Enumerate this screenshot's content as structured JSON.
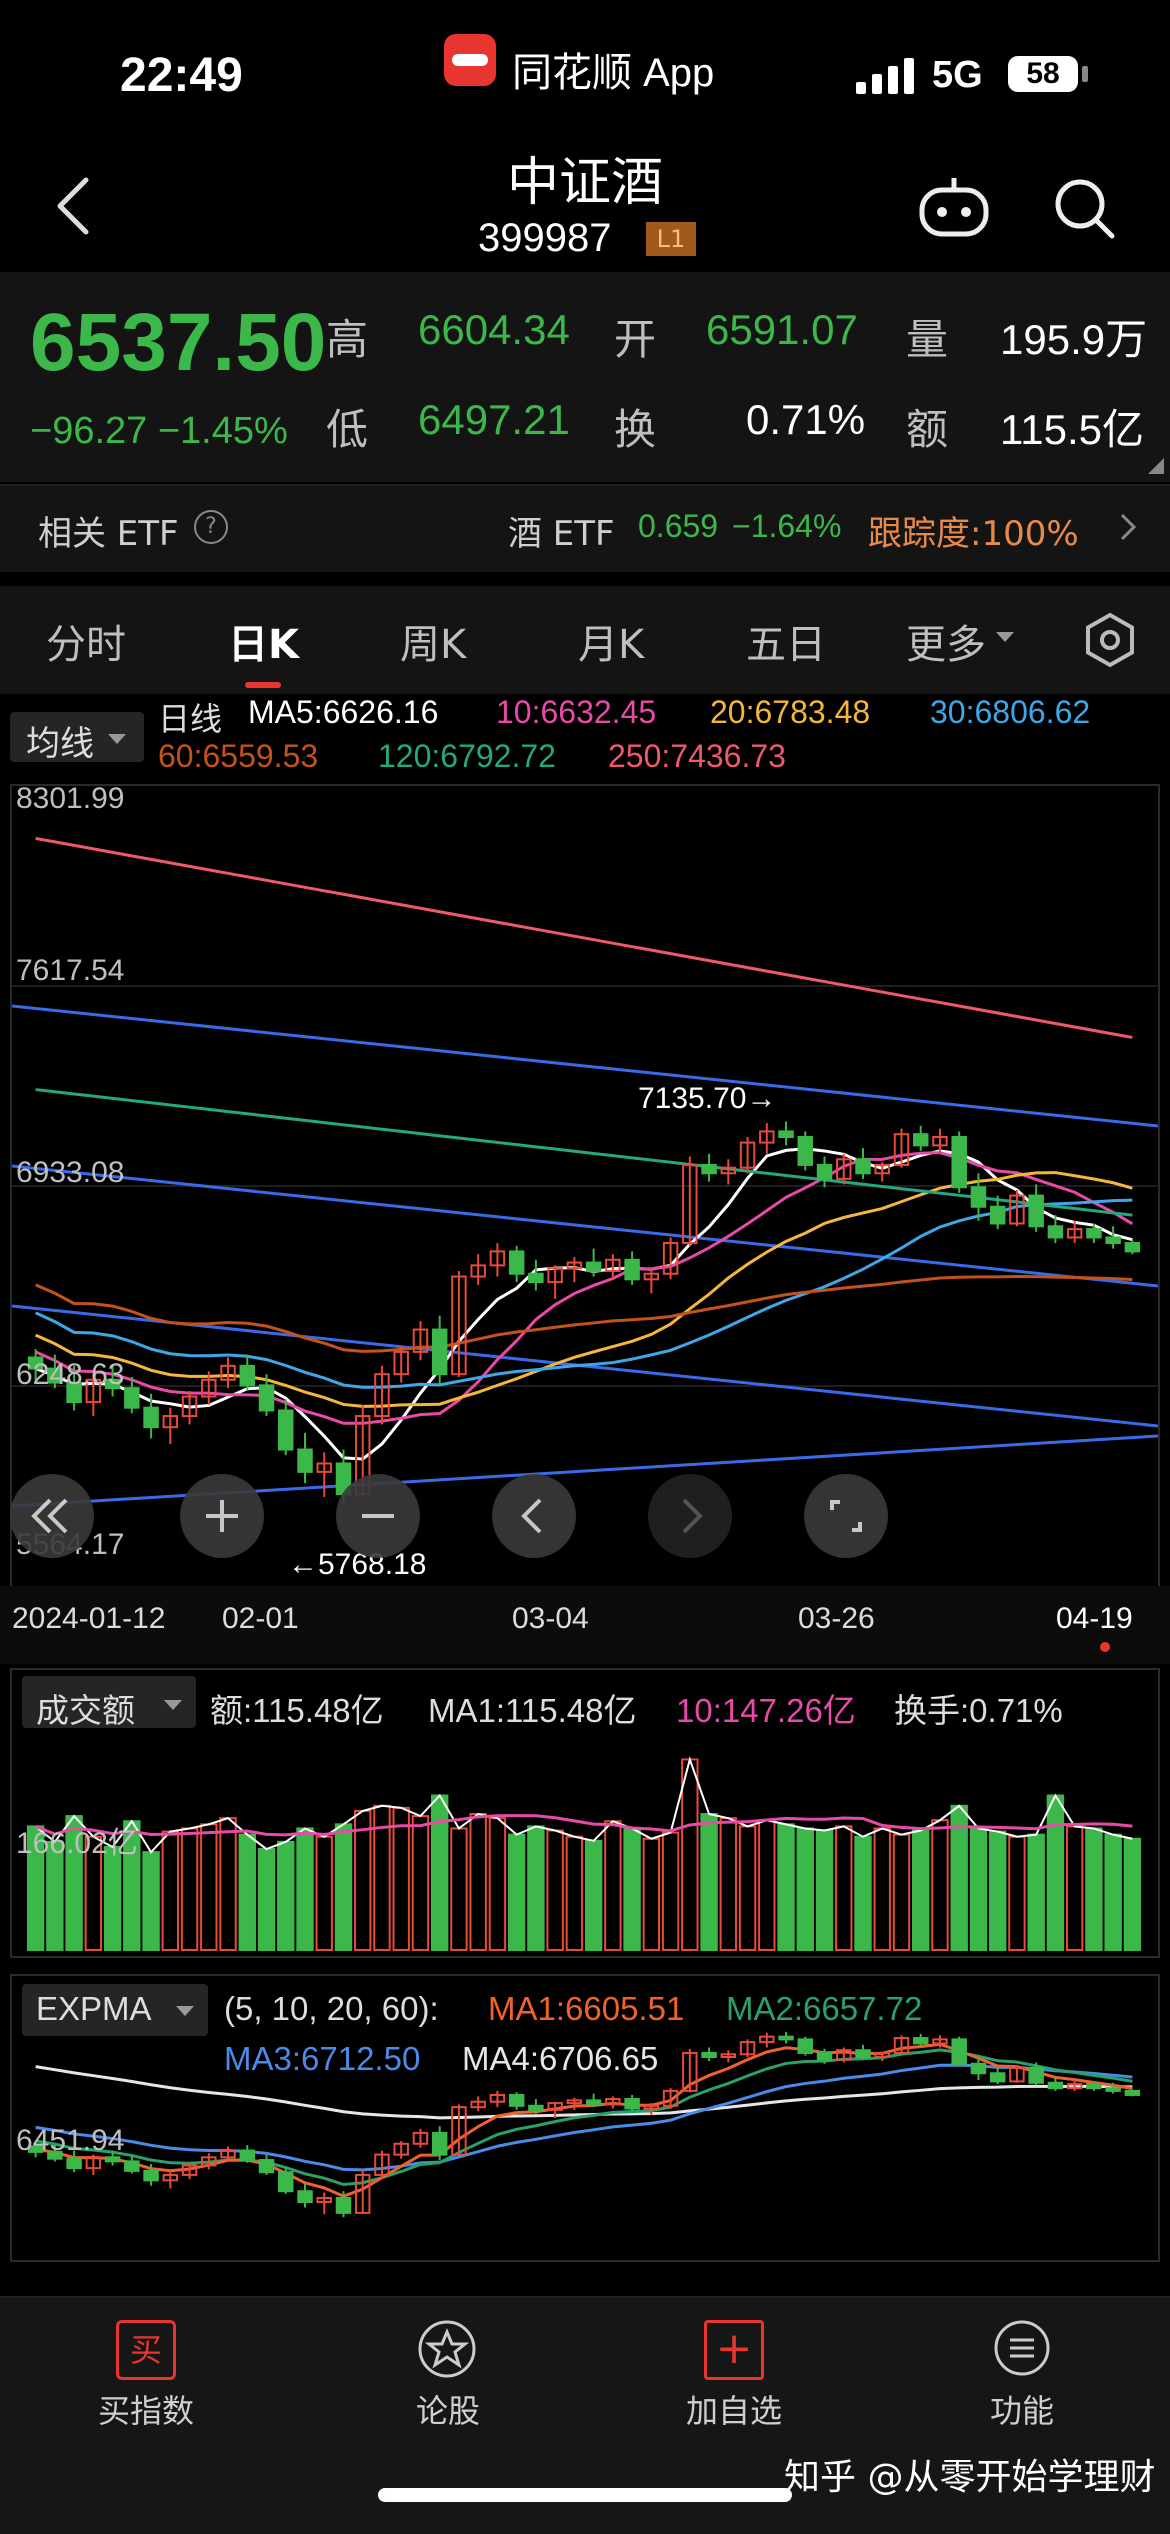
{
  "status_bar": {
    "time": "22:49",
    "app_name": "同花顺 App",
    "network": "5G",
    "battery": "58"
  },
  "header": {
    "title": "中证酒",
    "code": "399987",
    "level_badge": "L1"
  },
  "quote": {
    "price": "6537.50",
    "change": "−96.27  −1.45%",
    "high_label": "高",
    "high": "6604.34",
    "low_label": "低",
    "low": "6497.21",
    "open_label": "开",
    "open": "6591.07",
    "turnover_label": "换",
    "turnover": "0.71%",
    "volume_label": "量",
    "volume": "195.9万",
    "amount_label": "额",
    "amount": "115.5亿",
    "colors": {
      "down": "#3cb84a",
      "up": "#e84a3c"
    }
  },
  "etf": {
    "label": "相关 ETF",
    "help": "?",
    "name": "酒 ETF",
    "price": "0.659",
    "change": "−1.64%",
    "tracking": "跟踪度:100%"
  },
  "tabs": [
    "分时",
    "日K",
    "周K",
    "月K",
    "五日",
    "更多"
  ],
  "active_tab": "日K",
  "ma_legend": {
    "select": "均线",
    "period": "日线",
    "ma5": "MA5:6626.16",
    "ma10": "10:6632.45",
    "ma20": "20:6783.48",
    "ma30": "30:6806.62",
    "ma60": "60:6559.53",
    "ma120": "120:6792.72",
    "ma250": "250:7436.73",
    "colors": {
      "ma5": "#ffffff",
      "ma10": "#e84aa8",
      "ma20": "#f5b73b",
      "ma30": "#3fa7e8",
      "ma60": "#c4521c",
      "ma120": "#24a880",
      "ma250": "#ee5a6a"
    }
  },
  "kline_axis": {
    "y_ticks": [
      "8301.99",
      "7617.54",
      "6933.08",
      "6248.63",
      "5564.17"
    ],
    "high_marker": "7135.70→",
    "low_marker": "←5768.18",
    "x_ticks": [
      "2024-01-12",
      "02-01",
      "03-04",
      "03-26",
      "04-19"
    ]
  },
  "volume_panel": {
    "select": "成交额",
    "amount": "额:115.48亿",
    "ma1": "MA1:115.48亿",
    "ma10": "10:147.26亿",
    "turnover": "换手:0.71%",
    "y_tick": "166.02亿"
  },
  "expma_panel": {
    "select": "EXPMA",
    "params": "(5, 10, 20, 60):",
    "ma1": "MA1:6605.51",
    "ma2": "MA2:6657.72",
    "ma3": "MA3:6712.50",
    "ma4": "MA4:6706.65",
    "y_tick": "6451.94",
    "colors": {
      "ma1": "#f0622a",
      "ma2": "#2aa06a",
      "ma3": "#4a8ae8",
      "ma4": "#e6e6e6"
    }
  },
  "bottom_nav": [
    {
      "label": "买指数",
      "icon": "buy-icon",
      "glyph": "买"
    },
    {
      "label": "论股",
      "icon": "discuss-icon",
      "glyph": ""
    },
    {
      "label": "加自选",
      "icon": "add-watchlist-icon",
      "glyph": "+"
    },
    {
      "label": "功能",
      "icon": "menu-icon",
      "glyph": ""
    }
  ],
  "watermark": "知乎 @从零开始学理财",
  "chart_data": {
    "type": "candlestick",
    "title": "",
    "x_ticks": [
      "2024-01-12",
      "02-01",
      "03-04",
      "03-26",
      "04-19"
    ],
    "ylim": [
      5564.17,
      8301.99
    ],
    "ohlc": [
      [
        6290,
        6320,
        6210,
        6250
      ],
      [
        6250,
        6300,
        6180,
        6200
      ],
      [
        6200,
        6260,
        6100,
        6130
      ],
      [
        6130,
        6230,
        6080,
        6210
      ],
      [
        6210,
        6260,
        6150,
        6180
      ],
      [
        6180,
        6220,
        6090,
        6110
      ],
      [
        6110,
        6160,
        6000,
        6040
      ],
      [
        6040,
        6110,
        5980,
        6080
      ],
      [
        6080,
        6170,
        6050,
        6150
      ],
      [
        6150,
        6240,
        6120,
        6210
      ],
      [
        6210,
        6290,
        6180,
        6260
      ],
      [
        6260,
        6300,
        6170,
        6190
      ],
      [
        6190,
        6230,
        6080,
        6100
      ],
      [
        6100,
        6140,
        5940,
        5960
      ],
      [
        5960,
        6020,
        5840,
        5880
      ],
      [
        5880,
        5950,
        5790,
        5910
      ],
      [
        5910,
        5960,
        5768,
        5800
      ],
      [
        5800,
        6120,
        5790,
        6080
      ],
      [
        6080,
        6260,
        6050,
        6230
      ],
      [
        6230,
        6330,
        6200,
        6310
      ],
      [
        6310,
        6420,
        6280,
        6390
      ],
      [
        6390,
        6440,
        6190,
        6230
      ],
      [
        6230,
        6600,
        6220,
        6580
      ],
      [
        6580,
        6660,
        6550,
        6620
      ],
      [
        6620,
        6700,
        6580,
        6670
      ],
      [
        6670,
        6690,
        6560,
        6590
      ],
      [
        6590,
        6640,
        6530,
        6560
      ],
      [
        6560,
        6620,
        6500,
        6610
      ],
      [
        6610,
        6650,
        6560,
        6630
      ],
      [
        6630,
        6680,
        6580,
        6600
      ],
      [
        6600,
        6660,
        6570,
        6640
      ],
      [
        6640,
        6670,
        6550,
        6570
      ],
      [
        6570,
        6610,
        6520,
        6590
      ],
      [
        6590,
        6720,
        6570,
        6700
      ],
      [
        6700,
        7010,
        6690,
        6980
      ],
      [
        6980,
        7020,
        6920,
        6950
      ],
      [
        6950,
        7000,
        6910,
        6970
      ],
      [
        6970,
        7080,
        6950,
        7060
      ],
      [
        7060,
        7130,
        7020,
        7100
      ],
      [
        7100,
        7135.7,
        7050,
        7080
      ],
      [
        7080,
        7100,
        6960,
        6980
      ],
      [
        6980,
        7010,
        6900,
        6930
      ],
      [
        6930,
        7020,
        6910,
        7000
      ],
      [
        7000,
        7040,
        6930,
        6950
      ],
      [
        6950,
        6990,
        6920,
        6980
      ],
      [
        6980,
        7110,
        6970,
        7090
      ],
      [
        7090,
        7120,
        7030,
        7050
      ],
      [
        7050,
        7110,
        7020,
        7080
      ],
      [
        7080,
        7100,
        6880,
        6900
      ],
      [
        6900,
        6950,
        6780,
        6830
      ],
      [
        6830,
        6870,
        6750,
        6770
      ],
      [
        6770,
        6890,
        6760,
        6870
      ],
      [
        6870,
        6910,
        6740,
        6760
      ],
      [
        6760,
        6800,
        6700,
        6720
      ],
      [
        6720,
        6780,
        6700,
        6750
      ],
      [
        6750,
        6770,
        6700,
        6720
      ],
      [
        6720,
        6760,
        6680,
        6700
      ],
      [
        6700,
        6710,
        6660,
        6670
      ]
    ],
    "volume": [
      120,
      105,
      130,
      110,
      100,
      125,
      95,
      115,
      118,
      122,
      128,
      112,
      98,
      105,
      118,
      110,
      122,
      135,
      140,
      138,
      130,
      150,
      118,
      132,
      128,
      112,
      120,
      116,
      110,
      106,
      125,
      118,
      108,
      114,
      185,
      132,
      128,
      120,
      126,
      122,
      118,
      116,
      120,
      110,
      118,
      112,
      116,
      126,
      140,
      118,
      115,
      110,
      112,
      150,
      120,
      118,
      112,
      108
    ]
  }
}
